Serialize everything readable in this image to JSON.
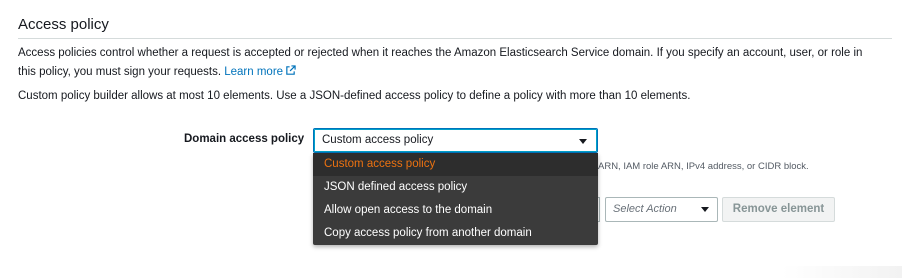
{
  "section": {
    "title": "Access policy",
    "description": "Access policies control whether a request is accepted or rejected when it reaches the Amazon Elasticsearch Service domain. If you specify an account, user, or role in this policy, you must sign your requests.",
    "learn_more": "Learn more",
    "builder_note": "Custom policy builder allows at most 10 elements. Use a JSON-defined access policy to define a policy with more than 10 elements."
  },
  "domain_access_policy": {
    "label": "Domain access policy",
    "selected": "Custom access policy",
    "options": [
      "Custom access policy",
      "JSON defined access policy",
      "Allow open access to the domain",
      "Copy access policy from another domain"
    ],
    "hint": "ARN, IAM role ARN, IPv4 address, or CIDR block."
  },
  "element_row": {
    "action_placeholder": "Select Action",
    "remove_label": "Remove element"
  },
  "colors": {
    "selected_option": "#ec7211",
    "link": "#0073bb",
    "menu_bg": "#3b3b3b"
  },
  "icons": {
    "external_link": "external-link-icon",
    "caret": "caret-down-icon"
  }
}
